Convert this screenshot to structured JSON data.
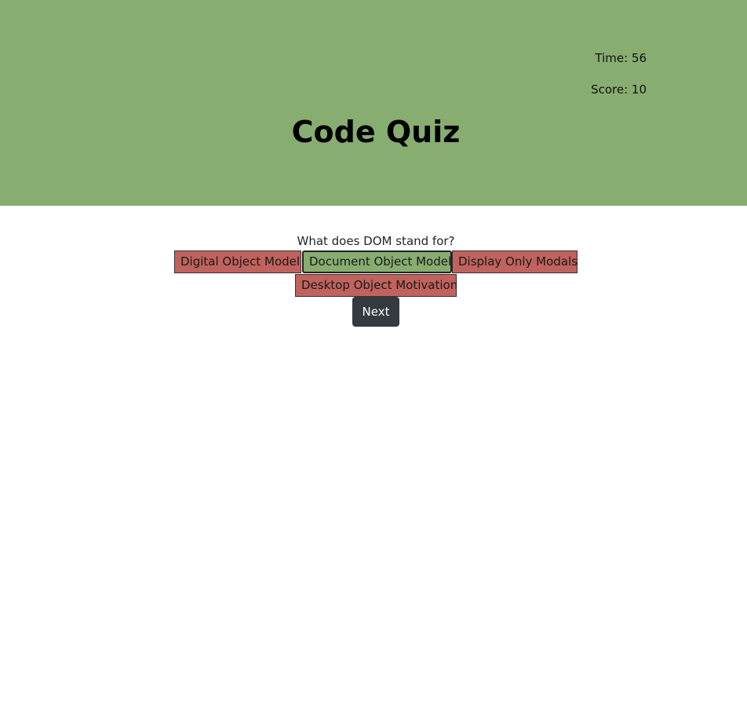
{
  "header": {
    "time_text": "Time: 56",
    "score_text": "Score: 10",
    "title": "Code Quiz"
  },
  "quiz": {
    "question": "What does DOM stand for?",
    "answers": [
      {
        "label": "Digital Object Model",
        "state": "incorrect"
      },
      {
        "label": "Document Object Model",
        "state": "correct"
      },
      {
        "label": "Display Only Modals",
        "state": "incorrect"
      },
      {
        "label": "Desktop Object Motivation",
        "state": "incorrect"
      }
    ],
    "next_label": "Next"
  },
  "colors": {
    "header_bg": "#87ad70",
    "correct": "#87ad70",
    "incorrect": "#c0625d",
    "next_button": "#343a40"
  }
}
